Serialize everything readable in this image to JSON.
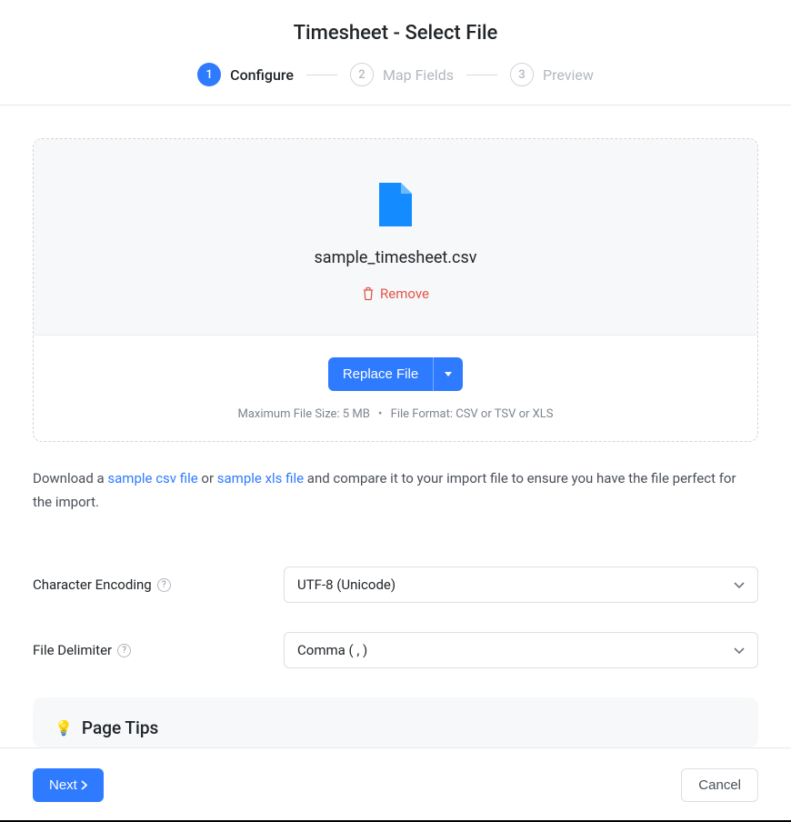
{
  "header": {
    "title": "Timesheet - Select File",
    "steps": [
      {
        "num": "1",
        "label": "Configure",
        "active": true
      },
      {
        "num": "2",
        "label": "Map Fields",
        "active": false
      },
      {
        "num": "3",
        "label": "Preview",
        "active": false
      }
    ]
  },
  "upload": {
    "file_name": "sample_timesheet.csv",
    "remove_label": "Remove",
    "replace_label": "Replace File",
    "hint_size": "Maximum File Size: 5 MB",
    "hint_format": "File Format: CSV or TSV or XLS"
  },
  "download": {
    "prefix": "Download a ",
    "csv_link": "sample csv file",
    "mid": " or ",
    "xls_link": "sample xls file",
    "suffix": " and compare it to your import file to ensure you have the file perfect for the import."
  },
  "form": {
    "encoding_label": "Character Encoding",
    "encoding_value": "UTF-8 (Unicode)",
    "delimiter_label": "File Delimiter",
    "delimiter_value": "Comma ( , )"
  },
  "tips": {
    "title": "Page Tips"
  },
  "footer": {
    "next": "Next",
    "cancel": "Cancel"
  }
}
